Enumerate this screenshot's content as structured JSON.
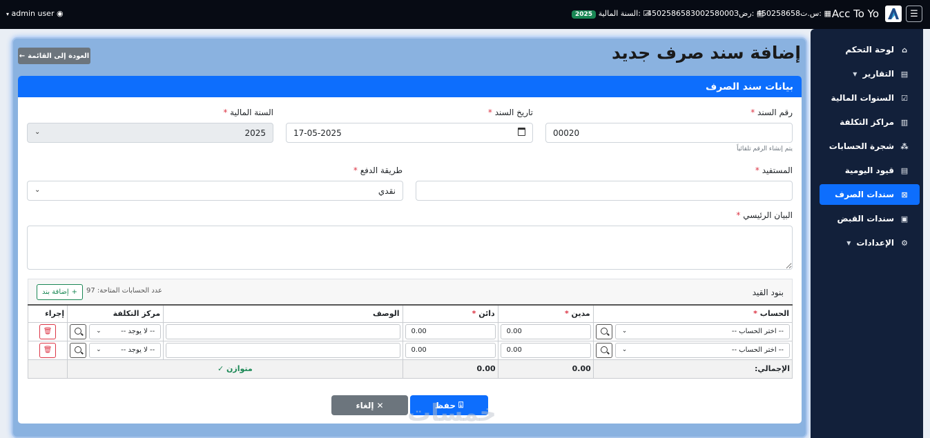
{
  "topbar": {
    "user": "admin user",
    "fiscal_year_label": "السنة المالية:",
    "fiscal_year_value": "2025",
    "vat_label": "رض:",
    "vat_value": "450258658300258000З",
    "cr_label": "س.ت:",
    "cr_value": "450258658",
    "brand": "Acc To Yo"
  },
  "sidebar": {
    "items": [
      {
        "label": "لوحة التحكم"
      },
      {
        "label": "التقارير"
      },
      {
        "label": "السنوات المالية"
      },
      {
        "label": "مراكز التكلفة"
      },
      {
        "label": "شجرة الحسابات"
      },
      {
        "label": "قيود اليومية"
      },
      {
        "label": "سندات الصرف"
      },
      {
        "label": "سندات القبض"
      },
      {
        "label": "الإعدادات"
      }
    ]
  },
  "page": {
    "title": "إضافة سند صرف جديد",
    "back_label": "العودة إلى القائمة",
    "card_title": "بيانات سند الصرف"
  },
  "form": {
    "voucher_no_label": "رقم السند",
    "voucher_no_value": "00020",
    "voucher_no_hint": "يتم إنشاء الرقم تلقائياً",
    "date_label": "تاريخ السند",
    "date_value": "17-05-2025",
    "fy_label": "السنة المالية",
    "fy_value": "2025",
    "beneficiary_label": "المستفيد",
    "beneficiary_value": "",
    "payment_label": "طريقة الدفع",
    "payment_value": "نقدي",
    "statement_label": "البيان الرئيسي",
    "statement_value": ""
  },
  "lines": {
    "title": "بنود القيد",
    "accounts_count_text": "عدد الحسابات المتاحة: 97",
    "add_label": "إضافة بند",
    "headers": {
      "account": "الحساب",
      "debit": "مدين",
      "credit": "دائن",
      "description": "الوصف",
      "cost_center": "مركز التكلفة",
      "action": "إجراء"
    },
    "rows": [
      {
        "account": "-- اختر الحساب --",
        "debit": "0.00",
        "credit": "0.00",
        "description": "",
        "cost_center": "-- لا يوجد --"
      },
      {
        "account": "-- اختر الحساب --",
        "debit": "0.00",
        "credit": "0.00",
        "description": "",
        "cost_center": "-- لا يوجد --"
      }
    ],
    "total_label": "الإجمالي:",
    "total_debit": "0.00",
    "total_credit": "0.00",
    "balanced_text": "متوازن ✓"
  },
  "actions": {
    "save_label": "حفظ",
    "cancel_label": "إلغاء"
  },
  "watermark": "خمسات",
  "colors": {
    "primary": "#0d6efd",
    "sidebar": "#12203a",
    "topbar": "#070b14",
    "success": "#198754",
    "danger": "#dc3545"
  }
}
